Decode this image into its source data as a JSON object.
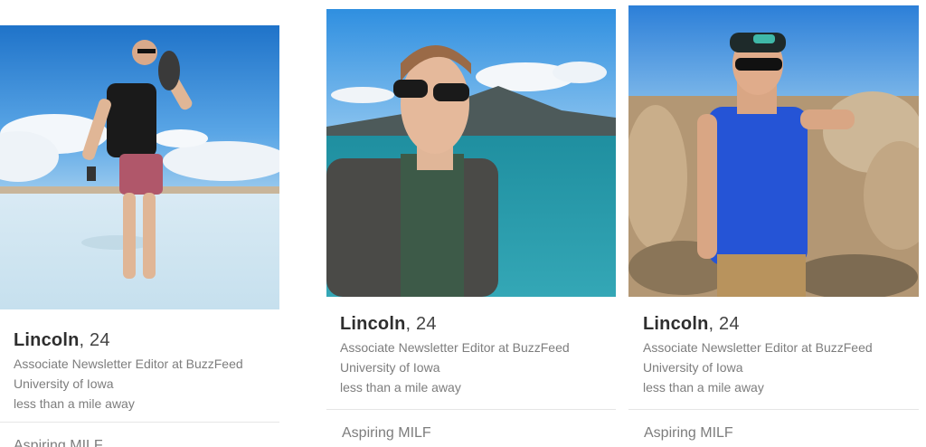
{
  "cards": [
    {
      "name": "Lincoln",
      "age": ", 24",
      "job": "Associate Newsletter Editor at BuzzFeed",
      "school": "University of Iowa",
      "distance": "less than a mile away",
      "bio": "Aspiring MILF"
    },
    {
      "name": "Lincoln",
      "age": ", 24",
      "job": "Associate Newsletter Editor at BuzzFeed",
      "school": "University of Iowa",
      "distance": "less than a mile away",
      "bio": "Aspiring MILF"
    },
    {
      "name": "Lincoln",
      "age": ", 24",
      "job": "Associate Newsletter Editor at BuzzFeed",
      "school": "University of Iowa",
      "distance": "less than a mile away",
      "bio": "Aspiring MILF"
    }
  ]
}
